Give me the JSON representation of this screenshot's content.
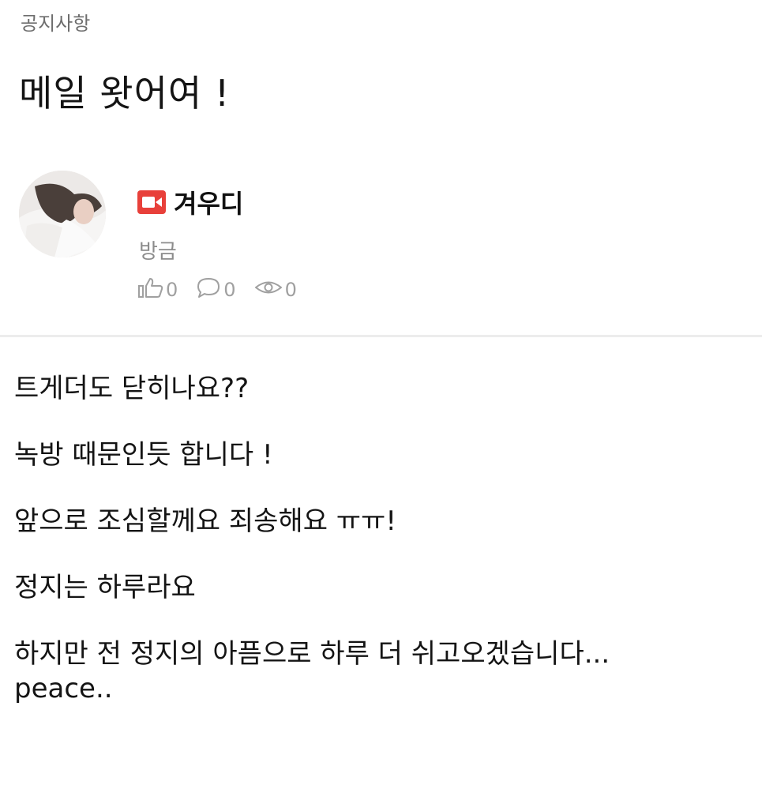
{
  "post": {
    "category": "공지사항",
    "title": "메일 왓어여 !",
    "author": {
      "name": "겨우디",
      "badge_icon": "live-camera-icon",
      "badge_color": "#e8403a",
      "time": "방금"
    },
    "stats": {
      "likes": "0",
      "comments": "0",
      "views": "0"
    },
    "body": {
      "line1": "트게더도 닫히나요??",
      "line2": "녹방 때문인듯 합니다 !",
      "line3": "앞으로 조심할께요 죄송해요 ㅠㅠ!",
      "line4": "정지는 하루라요",
      "line5": "하지만 전 정지의 아픔으로 하루 더 쉬고오겠습니다...",
      "line6": "peace.."
    }
  }
}
